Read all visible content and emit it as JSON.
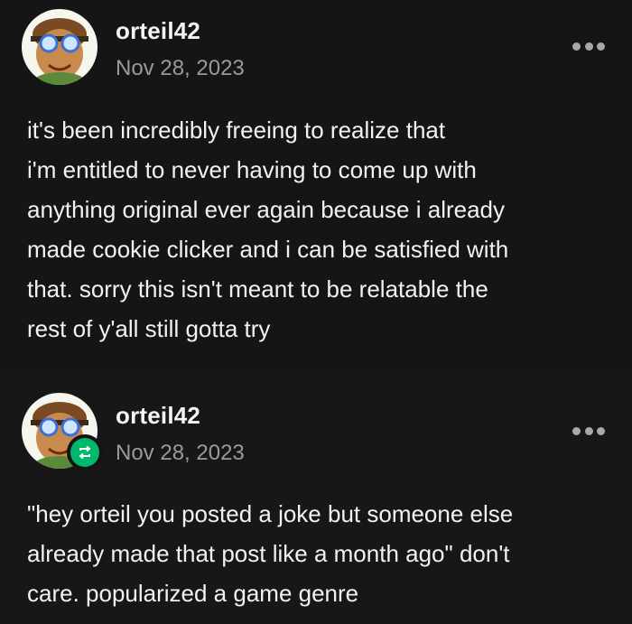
{
  "posts": [
    {
      "username": "orteil42",
      "date": "Nov 28, 2023",
      "text": "it's been incredibly freeing to realize that\ni'm entitled to never having to come up with\nanything original ever again because i already\nmade cookie clicker and i can be satisfied with\nthat. sorry this isn't meant to be relatable the\nrest of y'all still gotta try",
      "avatar_icon": "avatar-icon",
      "menu_icon": "more-options-icon"
    },
    {
      "username": "orteil42",
      "date": "Nov 28, 2023",
      "text": "\"hey orteil you posted a joke but someone else\nalready made that post like a month ago\" don't\ncare. popularized a game genre",
      "avatar_icon": "avatar-icon",
      "badge_icon": "reblog-icon",
      "menu_icon": "more-options-icon"
    }
  ],
  "colors": {
    "background": "#141414",
    "text": "#f2f2f2",
    "muted": "#9a9a9a",
    "reblog_green": "#00b86b"
  }
}
